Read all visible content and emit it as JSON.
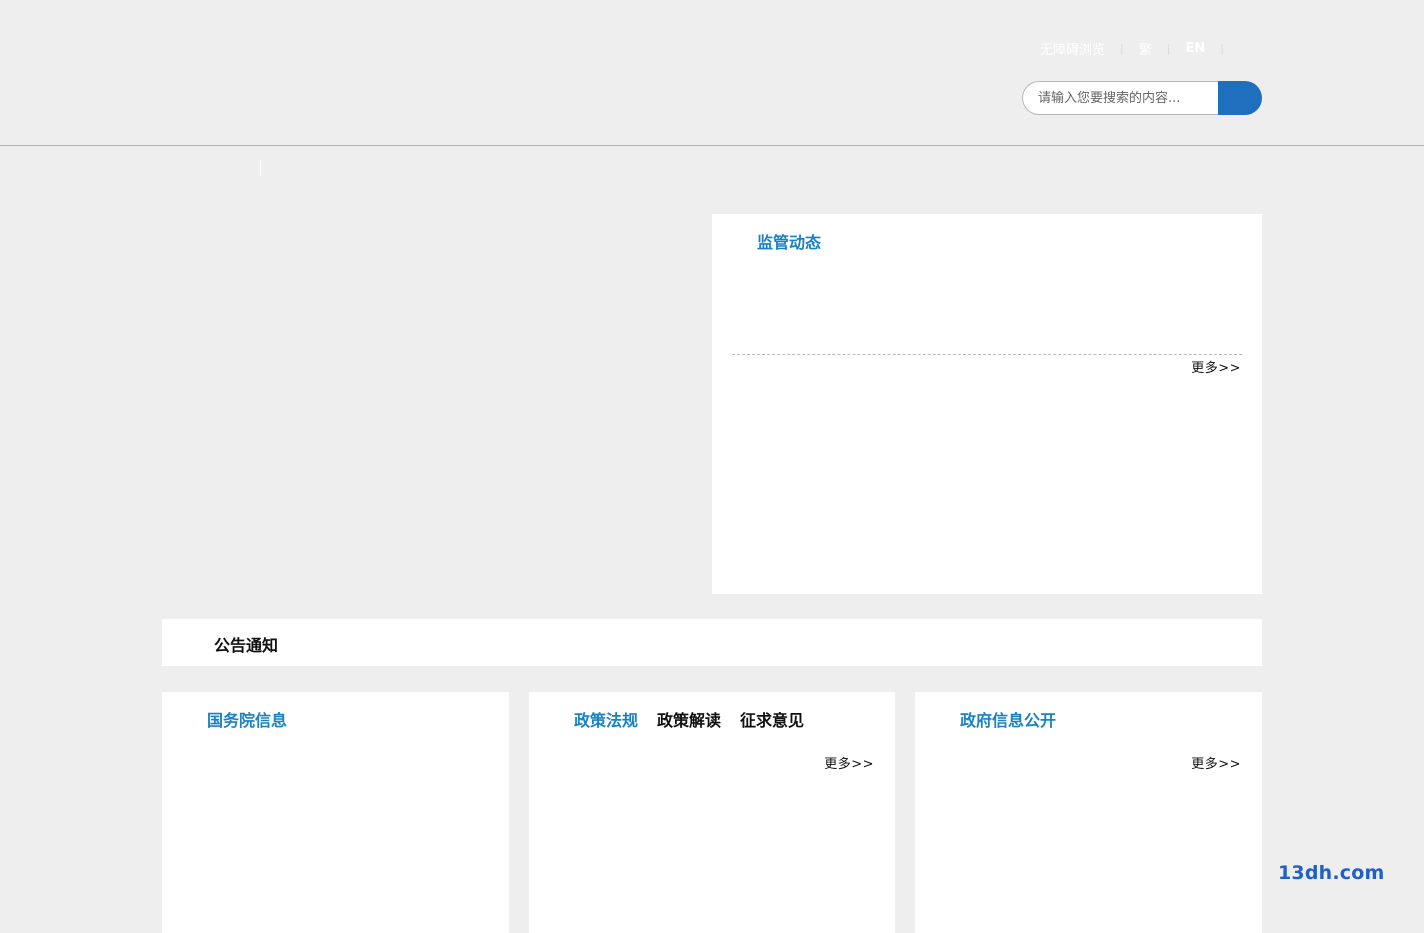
{
  "header": {
    "top_links": [
      {
        "label": "无障碍浏览"
      },
      {
        "label": "繁"
      },
      {
        "label": "EN"
      }
    ],
    "search": {
      "placeholder": "请输入您要搜索的内容...",
      "value": ""
    }
  },
  "sections": {
    "jianguan": {
      "title": "监管动态",
      "more": "更多>>"
    },
    "gonggao": {
      "title": "公告通知"
    },
    "guowuyuan": {
      "title": "国务院信息"
    },
    "zhengce": {
      "tabs": [
        {
          "label": "政策法规"
        },
        {
          "label": "政策解读"
        },
        {
          "label": "征求意见"
        }
      ],
      "more": "更多>>"
    },
    "xinxi": {
      "title": "政府信息公开",
      "more": "更多>>"
    }
  },
  "watermark": "13dh.com",
  "colors": {
    "background": "#eeeeee",
    "accent_blue": "#1a82c1",
    "search_button": "#1f6fbf",
    "header_line": "#7ec4e6"
  },
  "icons": {
    "search_button": "search-icon"
  }
}
